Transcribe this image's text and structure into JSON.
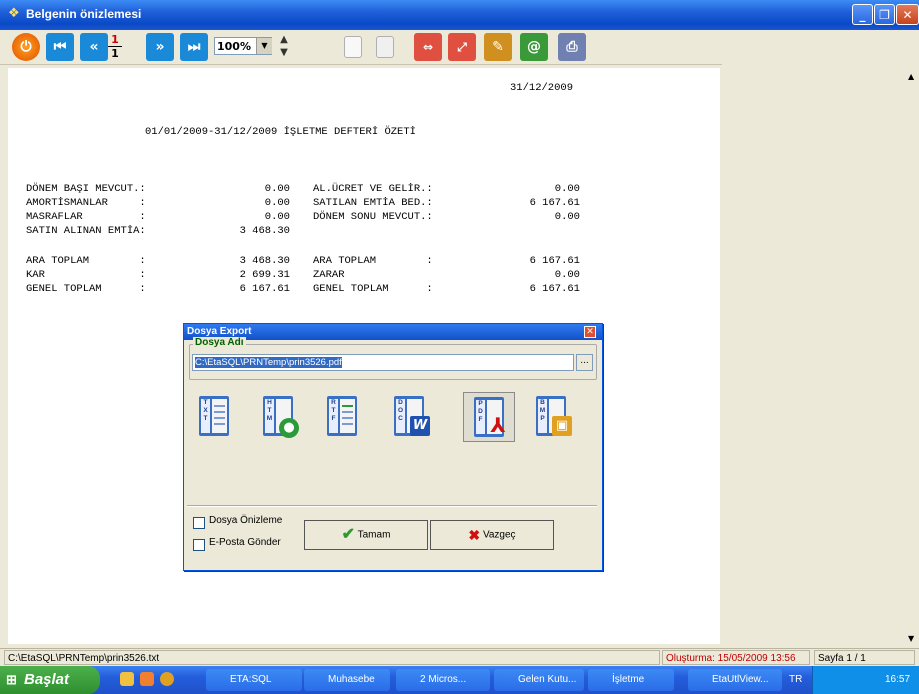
{
  "window": {
    "title": "Belgenin önizlemesi"
  },
  "toolbar": {
    "page_current": "1",
    "page_total": "1",
    "zoom": "100%",
    "icons": [
      "power-icon",
      "first-page-icon",
      "prev-page-icon",
      "next-page-icon",
      "last-page-icon",
      "zoom-stepper-icon",
      "page-icon",
      "pages-icon",
      "fit-width-icon",
      "fit-page-icon",
      "export-icon",
      "email-icon",
      "print-icon"
    ]
  },
  "document": {
    "date": "31/12/2009",
    "heading": "01/01/2009-31/12/2009 İŞLETME DEFTERİ ÖZETİ",
    "left_rows": [
      {
        "label": "DÖNEM BAŞI MEVCUT.:",
        "value": "0.00"
      },
      {
        "label": "AMORTİSMANLAR     :",
        "value": "0.00"
      },
      {
        "label": "MASRAFLAR         :",
        "value": "0.00"
      },
      {
        "label": "SATIN ALINAN EMTİA:",
        "value": "3 468.30"
      },
      {
        "label": "ARA TOPLAM        :",
        "value": "3 468.30"
      },
      {
        "label": "KAR               :",
        "value": "2 699.31"
      },
      {
        "label": "GENEL TOPLAM      :",
        "value": "6 167.61"
      }
    ],
    "right_rows": [
      {
        "label": "AL.ÜCRET VE GELİR.:",
        "value": "0.00"
      },
      {
        "label": "SATILAN EMTİA BED.:",
        "value": "6 167.61"
      },
      {
        "label": "DÖNEM SONU MEVCUT.:",
        "value": "0.00"
      },
      {
        "label": "ARA TOPLAM        :",
        "value": "6 167.61"
      },
      {
        "label": "ZARAR",
        "value": "0.00"
      },
      {
        "label": "GENEL TOPLAM      :",
        "value": "6 167.61"
      }
    ]
  },
  "dialog": {
    "title": "Dosya Export",
    "group_label": "Dosya Adı",
    "path": "C:\\EtaSQL\\PRNTemp\\prin3526.pdf",
    "browse_label": "...",
    "formats": [
      {
        "code": "TXT",
        "name": "txt-format-icon"
      },
      {
        "code": "HTM",
        "name": "htm-format-icon"
      },
      {
        "code": "RTF",
        "name": "rtf-format-icon"
      },
      {
        "code": "DOC",
        "name": "doc-format-icon"
      },
      {
        "code": "PDF",
        "name": "pdf-format-icon"
      },
      {
        "code": "BMP",
        "name": "bmp-format-icon"
      }
    ],
    "selected_format": "PDF",
    "check_preview": "Dosya Önizleme",
    "check_email": "E-Posta Gönder",
    "ok_label": "Tamam",
    "cancel_label": "Vazgeç"
  },
  "statusbar": {
    "file": "C:\\EtaSQL\\PRNTemp\\prin3526.txt",
    "created": "Oluşturma: 15/05/2009 13:56",
    "page": "Sayfa 1 / 1"
  },
  "taskbar": {
    "start": "Başlat",
    "items": [
      "ETA:SQL",
      "Muhasebe",
      "2 Micros...",
      "Gelen Kutu...",
      "İşletme",
      "EtaUtlView..."
    ],
    "lang": "TR",
    "clock": "16:57"
  },
  "colors": {
    "accent": "#0a49c6",
    "highlight": "#316ac5",
    "status_red": "#c00000"
  }
}
